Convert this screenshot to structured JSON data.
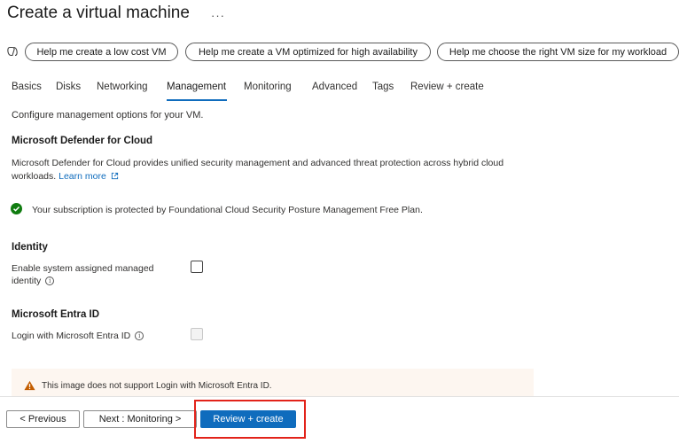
{
  "header": {
    "title": "Create a virtual machine",
    "more_label": "···"
  },
  "copilot": {
    "icon": "copilot-icon",
    "suggestions": [
      "Help me create a low cost VM",
      "Help me create a VM optimized for high availability",
      "Help me choose the right VM size for my workload"
    ]
  },
  "tabs": [
    "Basics",
    "Disks",
    "Networking",
    "Management",
    "Monitoring",
    "Advanced",
    "Tags",
    "Review + create"
  ],
  "active_tab": "Management",
  "intro": "Configure management options for your VM.",
  "defender": {
    "heading": "Microsoft Defender for Cloud",
    "description": "Microsoft Defender for Cloud provides unified security management and advanced threat protection across hybrid cloud workloads.",
    "learn_more": "Learn more",
    "status": "Your subscription is protected by Foundational Cloud Security Posture Management Free Plan."
  },
  "identity": {
    "heading": "Identity",
    "label_line1": "Enable system assigned managed",
    "label_line2": "identity",
    "checked": false
  },
  "entra": {
    "heading": "Microsoft Entra ID",
    "label": "Login with Microsoft Entra ID",
    "checked": false,
    "disabled": true,
    "warning": "This image does not support Login with Microsoft Entra ID."
  },
  "footer": {
    "previous": "< Previous",
    "next": "Next : Monitoring >",
    "review": "Review + create"
  },
  "colors": {
    "accent": "#0f6cbd",
    "success": "#107c10",
    "warning": "#c35d00",
    "highlight": "#e2231a"
  }
}
